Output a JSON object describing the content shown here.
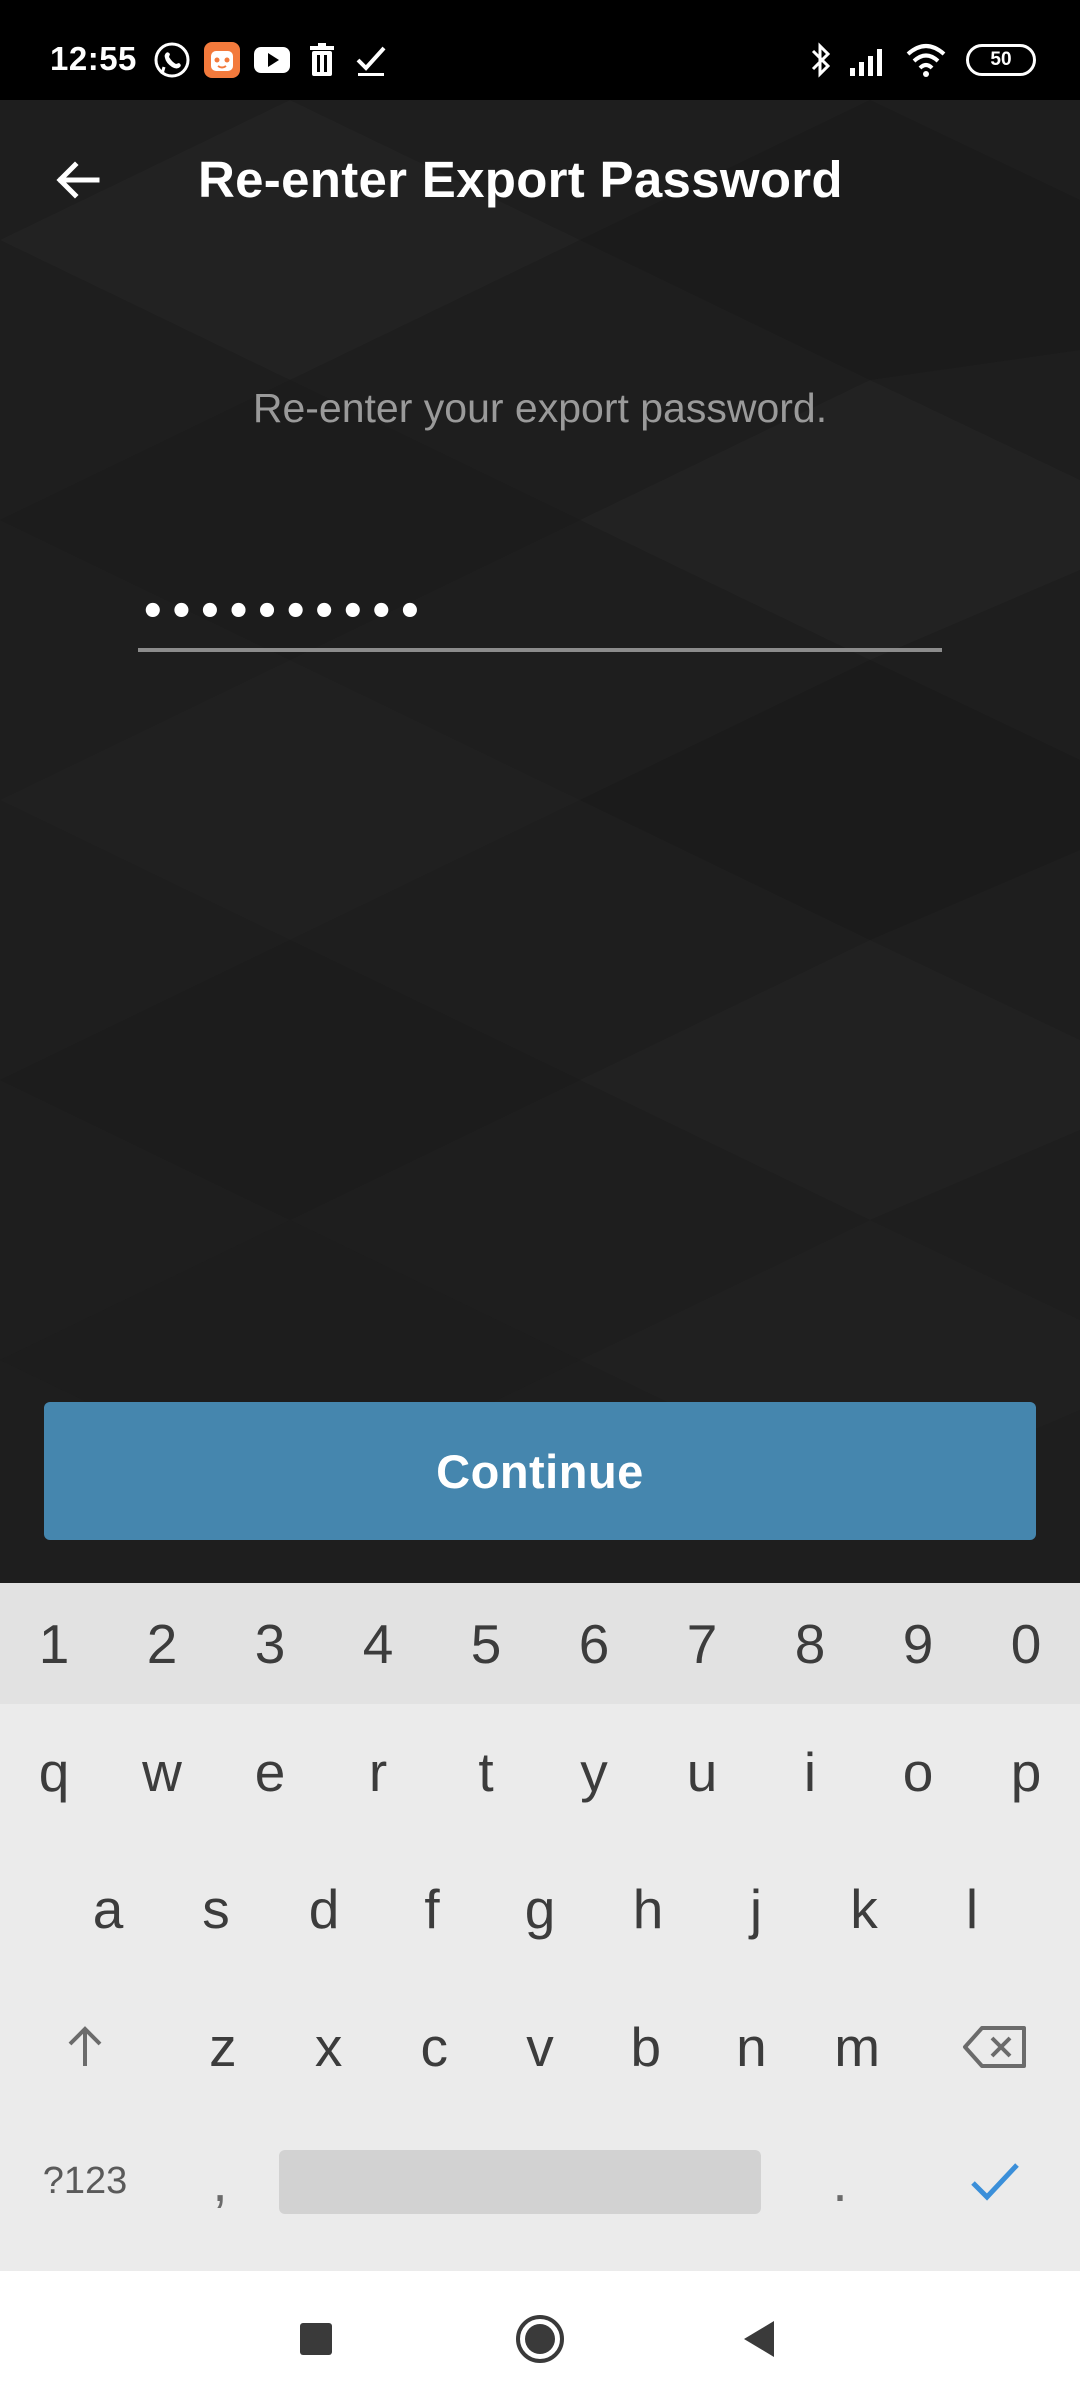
{
  "status_bar": {
    "time": "12:55",
    "notification_icons": [
      "viber-icon",
      "mi-app-icon",
      "youtube-icon",
      "trash-icon",
      "checkmark-icon"
    ],
    "system_icons": [
      "bluetooth-icon",
      "signal-icon",
      "wifi-icon",
      "battery-icon"
    ],
    "battery_level": "50"
  },
  "toolbar": {
    "title": "Re-enter Export Password",
    "back_icon": "arrow-left-icon"
  },
  "form": {
    "instruction": "Re-enter your export password.",
    "password_value": "••••••••••"
  },
  "continue_button": {
    "label": "Continue",
    "color": "#4586ae"
  },
  "keyboard": {
    "number_row": [
      "1",
      "2",
      "3",
      "4",
      "5",
      "6",
      "7",
      "8",
      "9",
      "0"
    ],
    "row1": [
      "q",
      "w",
      "e",
      "r",
      "t",
      "y",
      "u",
      "i",
      "o",
      "p"
    ],
    "row2": [
      "a",
      "s",
      "d",
      "f",
      "g",
      "h",
      "j",
      "k",
      "l"
    ],
    "row3": [
      "z",
      "x",
      "c",
      "v",
      "b",
      "n",
      "m"
    ],
    "symbols_label": "?123",
    "comma": ",",
    "period": ".",
    "done_icon": "checkmark-icon",
    "accent_color": "#3b8fd9"
  },
  "nav_bar": {
    "buttons": [
      "recents-icon",
      "home-icon",
      "back-icon"
    ]
  }
}
